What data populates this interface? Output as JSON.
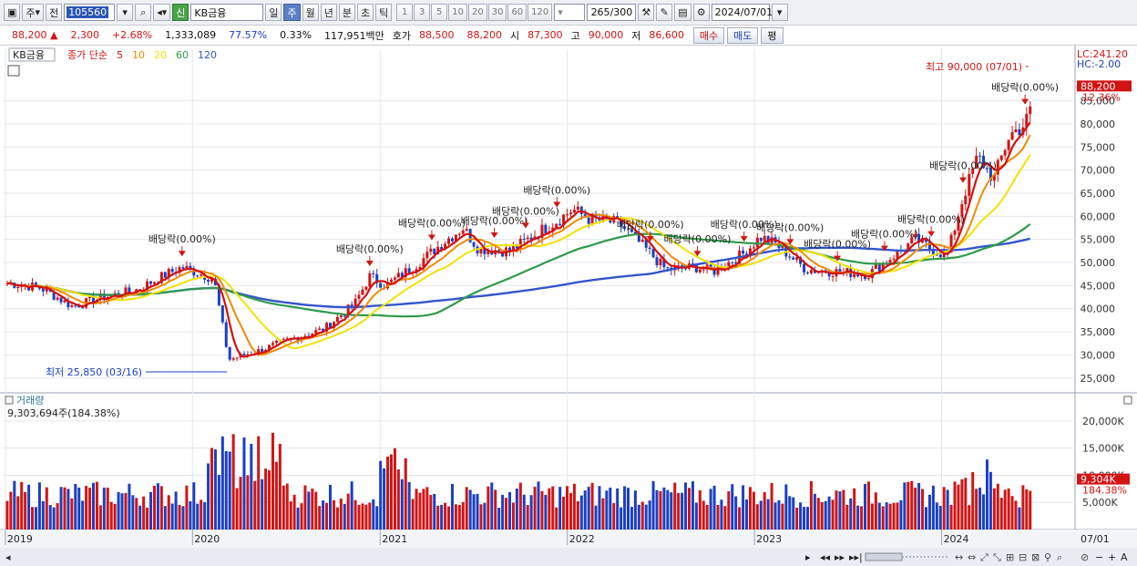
{
  "toolbar": {
    "period_main": "주",
    "prev_label": "전",
    "code": "105560",
    "badge": "신",
    "stock_name": "KB금융",
    "periods": [
      "일",
      "주",
      "월",
      "년",
      "분",
      "초",
      "틱"
    ],
    "selected_period": "주",
    "numbers": [
      "1",
      "3",
      "5",
      "10",
      "20",
      "30",
      "60",
      "120"
    ],
    "count": "265",
    "count_total": "/300",
    "date": "2024/07/01"
  },
  "quote": {
    "price": "88,200",
    "change_arrow": "▲",
    "change": "2,300",
    "change_pct": "+2.68%",
    "volume": "1,333,089",
    "vol_ratio": "77.57%",
    "turnover": "0.33%",
    "amount": "117,951백만",
    "ask_label": "호가",
    "ask1": "88,500",
    "ask2": "88,200",
    "open_label": "시",
    "open": "87,300",
    "high_label": "고",
    "high": "90,000",
    "low_label": "저",
    "low": "86,600",
    "buy": "매수",
    "sell": "매도",
    "avg": "평"
  },
  "colors": {
    "up": "#d21414",
    "down": "#1a3fc4",
    "ma5": "#d41010",
    "ma10": "#f08a00",
    "ma20": "#f2e200",
    "ma60": "#2e9a4a",
    "ma120": "#3355cc"
  },
  "chart_data": {
    "type": "candlestick",
    "title": "KB금융",
    "legend_label": "종가 단순",
    "ma_periods": [
      "5",
      "10",
      "20",
      "60",
      "120"
    ],
    "y_ticks": [
      "85,000",
      "80,000",
      "75,000",
      "70,000",
      "65,000",
      "60,000",
      "55,000",
      "50,000",
      "45,000",
      "40,000",
      "35,000",
      "30,000",
      "25,000"
    ],
    "ylim": [
      22000,
      93000
    ],
    "x_ticks": [
      "2019",
      "2020",
      "2021",
      "2022",
      "2023",
      "2024"
    ],
    "x_end_label": "07/01",
    "lc_label": "LC:241.20",
    "hc_label": "HC:-2.00",
    "last_price_label": "88,200",
    "last_pct_label": "12.36%",
    "high_note": "최고 90,000 (07/01)",
    "low_note": "최저 25,850 (03/16)",
    "dividend_labels": [
      {
        "text": "배당락(0.00%)",
        "date": "2019-12"
      },
      {
        "text": "배당락(0.00%)",
        "date": "2020-12"
      },
      {
        "text": "배당락(0.00%)",
        "date": "2021-04"
      },
      {
        "text": "배당락(0.00%)",
        "date": "2021-08"
      },
      {
        "text": "배당락(0.00%)",
        "date": "2021-10"
      },
      {
        "text": "배당락(0.00%)",
        "date": "2021-12"
      },
      {
        "text": "배당락(0.00%)",
        "date": "2022-06"
      },
      {
        "text": "배당락(0.00%)",
        "date": "2022-09"
      },
      {
        "text": "배당락(0.00%)",
        "date": "2022-12"
      },
      {
        "text": "배당락(0.00%)",
        "date": "2023-03"
      },
      {
        "text": "배당락(0.00%)",
        "date": "2023-06"
      },
      {
        "text": "배당락(0.00%)",
        "date": "2023-09"
      },
      {
        "text": "배당락(0.00%)",
        "date": "2023-12"
      },
      {
        "text": "배당락(0.00%)",
        "date": "2024-02"
      },
      {
        "text": "배당락(0.00%)",
        "date": "2024-06"
      }
    ],
    "price_path": [
      [
        "2019-01",
        45500
      ],
      [
        "2019-03",
        44500
      ],
      [
        "2019-05",
        40500
      ],
      [
        "2019-07",
        42500
      ],
      [
        "2019-09",
        44000
      ],
      [
        "2019-11",
        47500
      ],
      [
        "2019-12",
        49000
      ],
      [
        "2020-02",
        46500
      ],
      [
        "2020-03",
        29000
      ],
      [
        "2020-05",
        31000
      ],
      [
        "2020-07",
        33500
      ],
      [
        "2020-09",
        35500
      ],
      [
        "2020-11",
        41000
      ],
      [
        "2020-12",
        47000
      ],
      [
        "2021-01",
        45000
      ],
      [
        "2021-03",
        49500
      ],
      [
        "2021-05",
        55000
      ],
      [
        "2021-06",
        57500
      ],
      [
        "2021-07",
        53000
      ],
      [
        "2021-09",
        52500
      ],
      [
        "2021-11",
        57000
      ],
      [
        "2021-12",
        59000
      ],
      [
        "2022-01",
        61500
      ],
      [
        "2022-02",
        59500
      ],
      [
        "2022-04",
        58500
      ],
      [
        "2022-06",
        52000
      ],
      [
        "2022-07",
        48500
      ],
      [
        "2022-09",
        49000
      ],
      [
        "2022-10",
        48000
      ],
      [
        "2022-12",
        52000
      ],
      [
        "2023-01",
        55500
      ],
      [
        "2023-02",
        54000
      ],
      [
        "2023-04",
        48500
      ],
      [
        "2023-06",
        48000
      ],
      [
        "2023-08",
        47500
      ],
      [
        "2023-10",
        52500
      ],
      [
        "2023-11",
        55000
      ],
      [
        "2023-12",
        53000
      ],
      [
        "2024-01",
        51500
      ],
      [
        "2024-02",
        64000
      ],
      [
        "2024-03",
        73000
      ],
      [
        "2024-04",
        68000
      ],
      [
        "2024-05",
        77500
      ],
      [
        "2024-06",
        80000
      ],
      [
        "2024-07",
        88200
      ]
    ],
    "volume_panel": {
      "label": "거래량",
      "current": "9,303,694주(184.38%)",
      "y_ticks": [
        "20,000K",
        "15,000K",
        "10,000K",
        "5,000K"
      ],
      "ylim": [
        0,
        22000
      ],
      "last_label": "9,304K",
      "last_pct": "184.38%"
    }
  }
}
